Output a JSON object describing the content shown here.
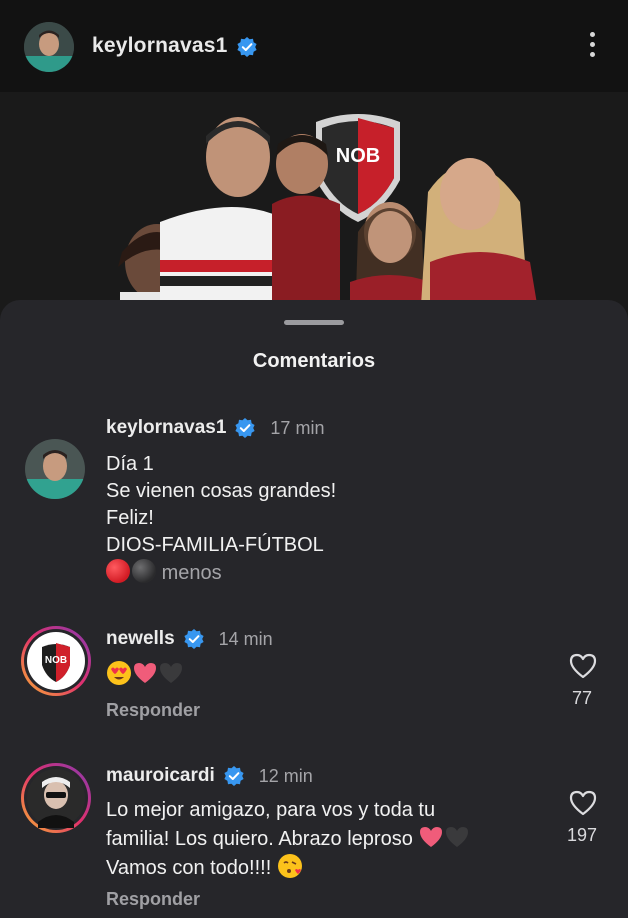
{
  "post": {
    "username": "keylornavas1",
    "photo_crest_text": "NOB"
  },
  "sheet": {
    "title": "Comentarios"
  },
  "comments": [
    {
      "username": "keylornavas1",
      "time": "17 min",
      "lines": [
        "Día 1",
        "Se vienen cosas grandes!",
        "Feliz!",
        "DIOS-FAMILIA-FÚTBOL"
      ],
      "less_label": "menos"
    },
    {
      "username": "newells",
      "time": "14 min",
      "avatar_text": "NOB",
      "likes": "77",
      "reply_label": "Responder"
    },
    {
      "username": "mauroicardi",
      "time": "12 min",
      "lines": [
        "Lo mejor amigazo, para vos y toda tu",
        "familia! Los quiero. Abrazo leproso",
        "Vamos con todo!!!!"
      ],
      "likes": "197",
      "reply_label": "Responder"
    }
  ],
  "icons": {
    "verified": "verified-badge-icon",
    "more": "more-vertical-icon",
    "like": "heart-outline-icon"
  },
  "colors": {
    "verified_blue": "#3897f0",
    "sheet_bg": "#26262a",
    "newells_red": "#d0202a"
  }
}
